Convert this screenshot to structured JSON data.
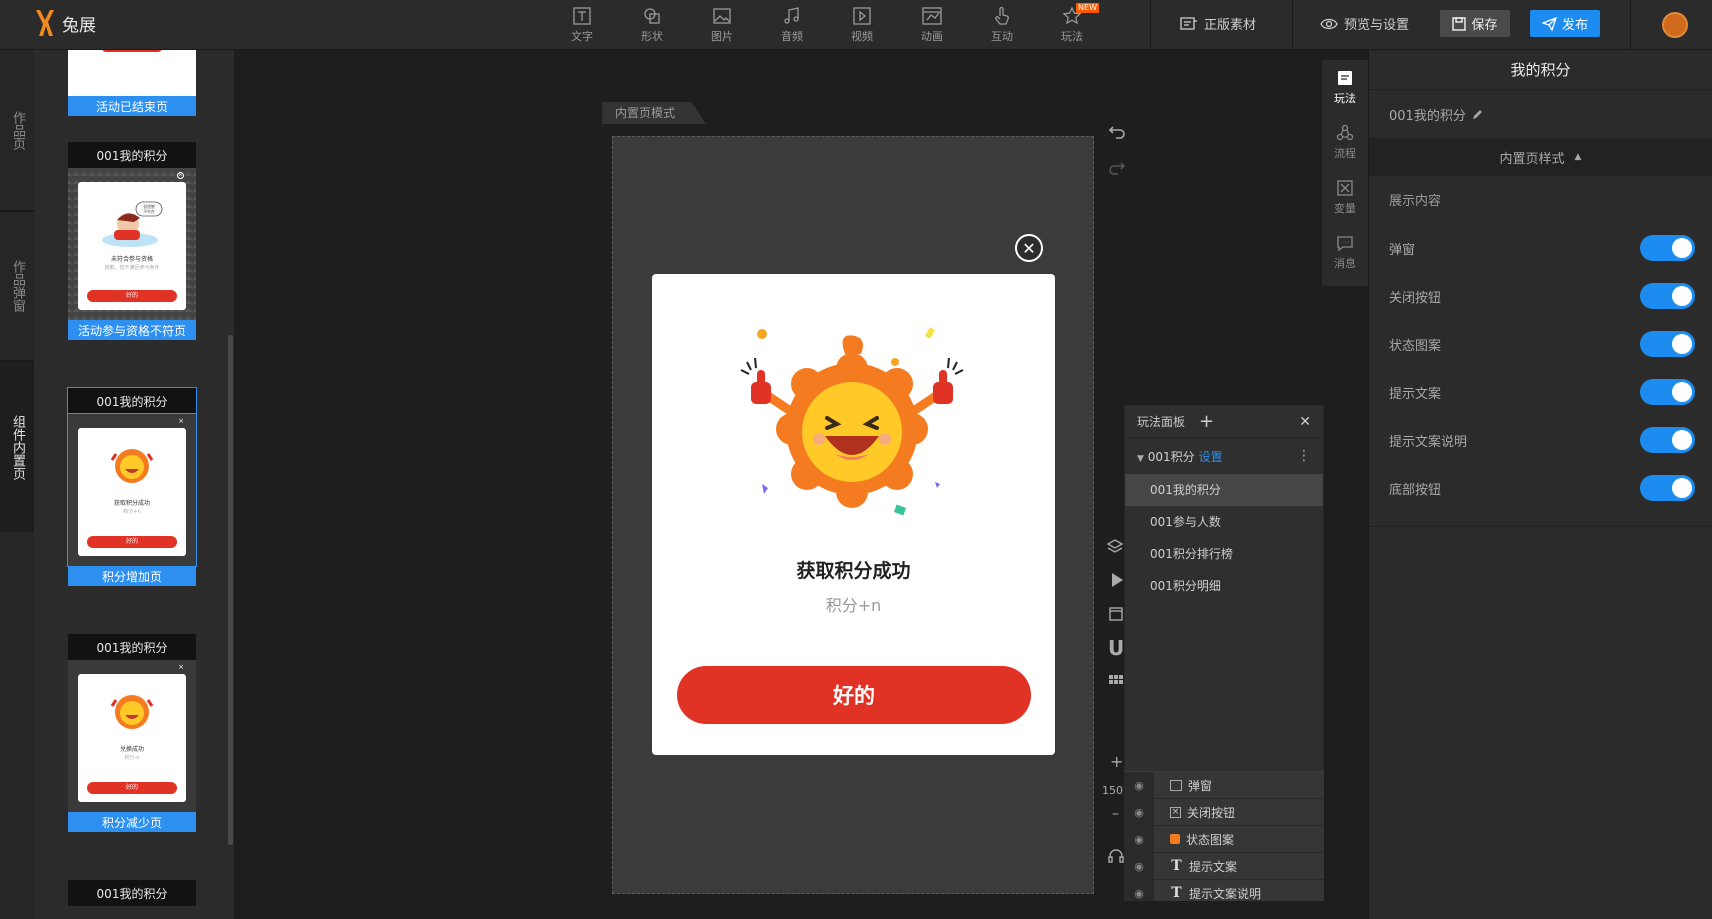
{
  "app": {
    "logo_text": "兔展"
  },
  "toolbar": {
    "tools": [
      {
        "label": "文字",
        "icon": "text-icon"
      },
      {
        "label": "形状",
        "icon": "shape-icon"
      },
      {
        "label": "图片",
        "icon": "image-icon"
      },
      {
        "label": "音频",
        "icon": "music-icon"
      },
      {
        "label": "视频",
        "icon": "video-icon"
      },
      {
        "label": "动画",
        "icon": "animation-icon"
      },
      {
        "label": "互动",
        "icon": "hand-icon"
      },
      {
        "label": "玩法",
        "icon": "star-icon",
        "badge": "NEW"
      }
    ],
    "licensed_assets": "正版素材",
    "preview_settings": "预览与设置",
    "save": "保存",
    "publish": "发布"
  },
  "left_tabs": [
    "作品页",
    "作品弹窗",
    "组件内置页"
  ],
  "thumbnails": [
    {
      "title": "",
      "label": "活动已结束页"
    },
    {
      "title": "001我的积分",
      "label": "活动参与资格不符页",
      "card_text": "未符合参与资格",
      "card_sub": "抱歉，您不满足参与条件",
      "btn": "好的",
      "bubble": "很遗憾\n不符合"
    },
    {
      "title": "001我的积分",
      "label": "积分增加页",
      "card_text": "获取积分成功",
      "card_sub": "积分+n",
      "btn": "好的"
    },
    {
      "title": "001我的积分",
      "label": "积分减少页",
      "card_text": "兑换成功",
      "card_sub": "积分-n",
      "btn": "好的"
    },
    {
      "title": "001我的积分",
      "label": ""
    }
  ],
  "canvas": {
    "mode_tab": "内置页模式",
    "zoom": "150",
    "modal": {
      "title": "获取积分成功",
      "subtitle": "积分+n",
      "button": "好的"
    }
  },
  "play_panel": {
    "title": "玩法面板",
    "group": "001积分",
    "group_link": "设置",
    "items": [
      "001我的积分",
      "001参与人数",
      "001积分排行榜",
      "001积分明细"
    ],
    "active_index": 0
  },
  "layers": [
    {
      "name": "弹窗",
      "icon": "popup-layer-icon"
    },
    {
      "name": "关闭按钮",
      "icon": "close-layer-icon"
    },
    {
      "name": "状态图案",
      "icon": "image-layer-icon"
    },
    {
      "name": "提示文案",
      "icon": "text-layer-icon"
    },
    {
      "name": "提示文案说明",
      "icon": "text-layer-icon"
    }
  ],
  "side_icons": [
    {
      "label": "玩法",
      "icon": "play-icon"
    },
    {
      "label": "流程",
      "icon": "flow-icon"
    },
    {
      "label": "变量",
      "icon": "variable-icon"
    },
    {
      "label": "消息",
      "icon": "message-icon"
    }
  ],
  "right_panel": {
    "title": "我的积分",
    "name": "001我的积分",
    "style_section": "内置页样式",
    "section": "展示内容",
    "rows": [
      {
        "label": "弹窗",
        "on": true
      },
      {
        "label": "关闭按钮",
        "on": true
      },
      {
        "label": "状态图案",
        "on": true
      },
      {
        "label": "提示文案",
        "on": true
      },
      {
        "label": "提示文案说明",
        "on": true
      },
      {
        "label": "底部按钮",
        "on": true
      }
    ]
  },
  "colors": {
    "accent": "#1d8cf0",
    "danger": "#e03325",
    "sun": "#f5a623"
  }
}
